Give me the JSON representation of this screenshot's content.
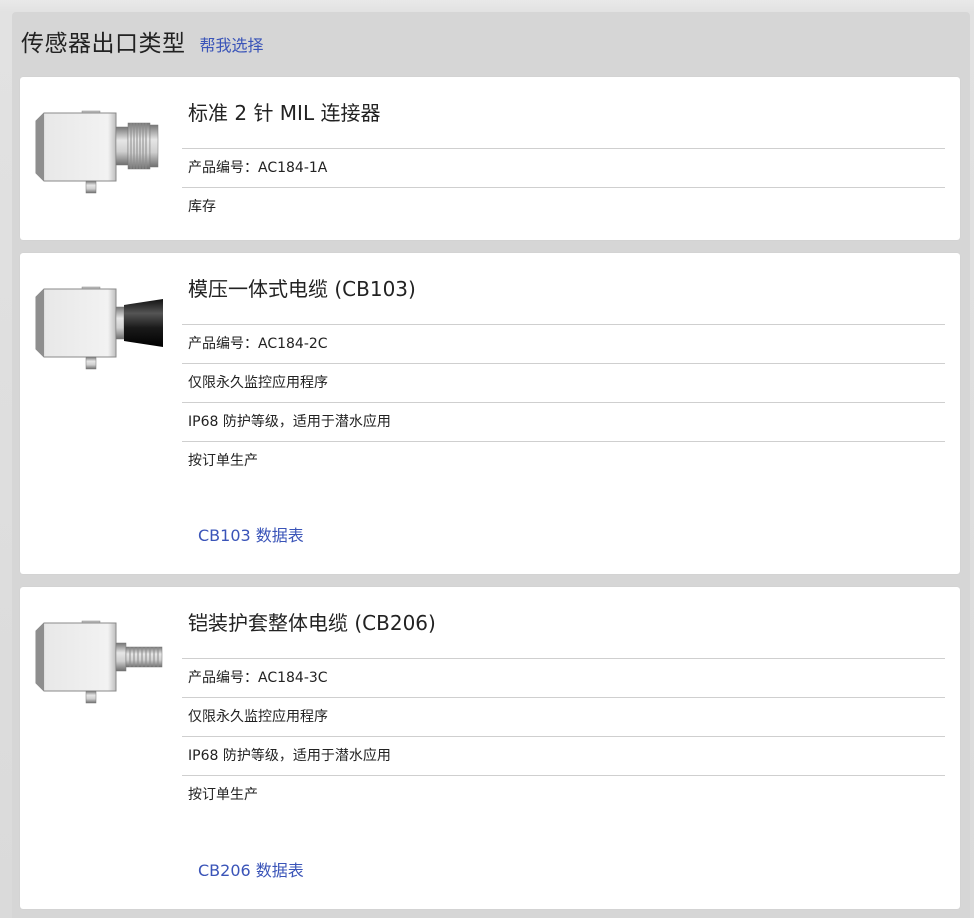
{
  "header": {
    "title": "传感器出口类型",
    "help_link": "帮我选择"
  },
  "products": [
    {
      "title": "标准 2 针 MIL 连接器",
      "image_icon": "sensor-mil-connector-icon",
      "attributes": [
        "产品编号：AC184-1A",
        "库存"
      ]
    },
    {
      "title": "模压一体式电缆 (CB103)",
      "image_icon": "sensor-molded-cable-icon",
      "attributes": [
        "产品编号：AC184-2C",
        "仅限永久监控应用程序",
        "IP68 防护等级，适用于潜水应用",
        "按订单生产"
      ],
      "datasheet_link": "CB103 数据表"
    },
    {
      "title": "铠装护套整体电缆 (CB206)",
      "image_icon": "sensor-armored-cable-icon",
      "attributes": [
        "产品编号：AC184-3C",
        "仅限永久监控应用程序",
        "IP68 防护等级，适用于潜水应用",
        "按订单生产"
      ],
      "datasheet_link": "CB206 数据表"
    }
  ],
  "colors": {
    "link": "#3a54b8",
    "panel_bg": "#d6d6d6",
    "card_bg": "#ffffff",
    "divider": "#cfcfcf"
  }
}
